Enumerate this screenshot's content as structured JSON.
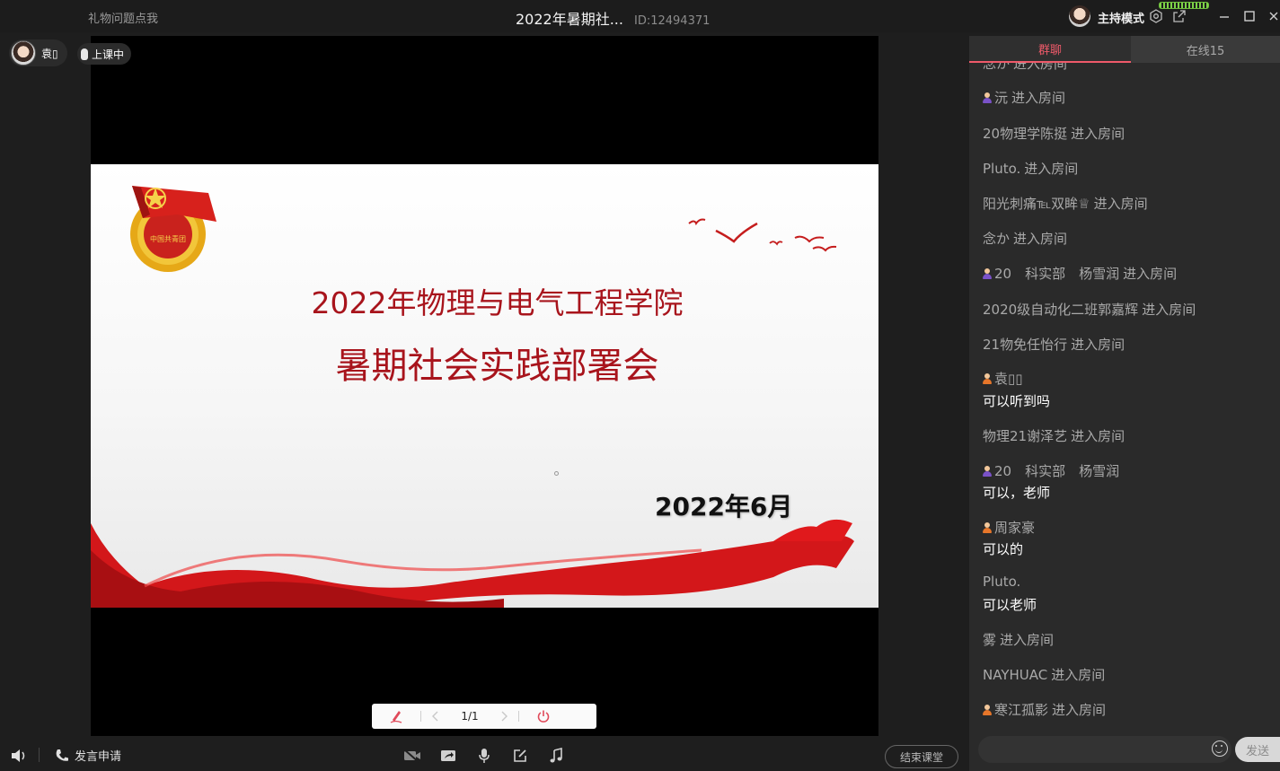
{
  "topbar": {
    "gift_link": "礼物问题点我",
    "room_title": "2022年暑期社...",
    "room_id": "ID:12494371",
    "host_mode": "主持模式"
  },
  "presenter": {
    "name": "袁▯",
    "status": "上课中"
  },
  "slide": {
    "title_line1": "2022年物理与电气工程学院",
    "title_line2": "暑期社会实践部署会",
    "date": "2022年6月",
    "accent_color": "#a8141c"
  },
  "pager": {
    "page": "1/1"
  },
  "bottombar": {
    "apply_speak": "发言申请",
    "end_class": "结束课堂"
  },
  "panel": {
    "tab_chat": "群聊",
    "tab_online": "在线15",
    "messages": [
      {
        "nick": "念か",
        "action": "进入房间"
      },
      {
        "nick": "沅",
        "action": "进入房间"
      },
      {
        "nick": "20物理学陈挺",
        "action": "进入房间"
      },
      {
        "nick": "Pluto.",
        "action": "进入房间"
      },
      {
        "nick": "阳光刺痛℡双眸♕",
        "action": "进入房间"
      },
      {
        "nick": "念か",
        "action": "进入房间"
      },
      {
        "nick": "20　科实部　杨雪润",
        "action": "进入房间"
      },
      {
        "nick": "2020级自动化二班郭嘉辉",
        "action": "进入房间"
      },
      {
        "nick": "21物免任怡行",
        "action": "进入房间"
      },
      {
        "nick": "袁▯▯",
        "text": "可以听到吗"
      },
      {
        "nick": "物理21谢泽艺",
        "action": "进入房间"
      },
      {
        "nick": "20　科实部　杨雪润",
        "text": "可以，老师"
      },
      {
        "nick": "周家豪",
        "text": "可以的"
      },
      {
        "nick": "Pluto.",
        "text": "可以老师"
      },
      {
        "nick": "雾",
        "action": "进入房间"
      },
      {
        "nick": "NAYHUAC",
        "action": "进入房间"
      },
      {
        "nick": "寒江孤影",
        "action": "进入房间"
      }
    ],
    "send_label": "发送"
  }
}
